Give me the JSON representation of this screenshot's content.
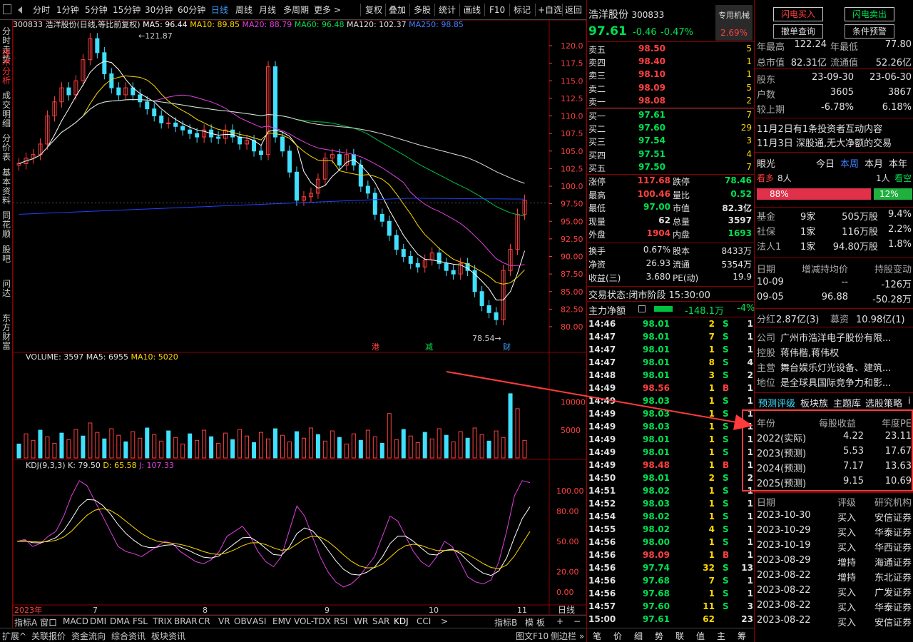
{
  "toolbar": {
    "items": [
      "分时",
      "1分钟",
      "5分钟",
      "15分钟",
      "30分钟",
      "60分钟",
      "日线",
      "周线",
      "月线",
      "多周期",
      "更多 >"
    ],
    "right_items": [
      "复权",
      "叠加",
      "多股",
      "统计",
      "画线",
      "F10",
      "标记",
      "+自选",
      "返回"
    ]
  },
  "left_tabs": [
    "分时走势",
    "技术分析",
    "成交明细",
    "分价表",
    "基本资料",
    "同花顺",
    "股吧",
    "问达",
    "东方财富"
  ],
  "chart": {
    "title": "300833 浩洋股份(日线,等比前复权)",
    "ma5": "MA5: 96.44",
    "ma10": "MA10: 89.85",
    "ma20": "MA20: 88.79",
    "ma60": "MA60: 96.48",
    "ma120": "MA120: 102.37",
    "ma250": "MA250: 98.85",
    "high_mark": "121.87",
    "low_mark": "78.54",
    "price_axis": [
      "120.0",
      "117.5",
      "115.0",
      "112.5",
      "110.0",
      "107.5",
      "105.0",
      "102.5",
      "100.0",
      "97.50",
      "95.00",
      "92.50",
      "90.00",
      "87.50",
      "85.00",
      "82.50",
      "80.00"
    ],
    "event_marks": [
      "港",
      "减",
      "财"
    ],
    "volume_title": "VOLUME: 3597",
    "vol_ma5": "MA5: 6955",
    "vol_ma10": "MA10: 5020",
    "vol_axis": [
      "10000",
      "5000"
    ],
    "kdj_title": "KDJ(9,3,3)",
    "kdj_k": "K: 79.50",
    "kdj_d": "D: 65.58",
    "kdj_j": "J: 107.33",
    "kdj_axis": [
      "100.00",
      "80.00",
      "50.00",
      "20.00",
      "0.00"
    ],
    "x_labels": [
      "2023年",
      "7",
      "8",
      "9",
      "10",
      "11"
    ],
    "period_label": "日线"
  },
  "bottom_tabs": [
    "指标A",
    "窗口",
    "MACD",
    "DMI",
    "DMA",
    "FSL",
    "TRIX",
    "BRAR",
    "CR",
    "VR",
    "OBV",
    "ASI",
    "EMV",
    "VOL-TDX",
    "RSI",
    "WR",
    "SAR",
    "KDJ",
    "CCI",
    ">"
  ],
  "bottom_right": [
    "指标B",
    "模",
    "板"
  ],
  "footer": [
    "扩展^",
    "关联报价",
    "资金流向",
    "综合资讯",
    "板块资讯"
  ],
  "footer_right": [
    "图文F10",
    "侧边栏 »"
  ],
  "quote": {
    "name": "浩洋股份",
    "code": "300833",
    "badge": "专用机械",
    "price": "97.61",
    "change": "-0.46",
    "pct": "-0.47%",
    "badge_pct": "2.69%",
    "asks": [
      {
        "label": "卖五",
        "price": "98.50",
        "vol": "5"
      },
      {
        "label": "卖四",
        "price": "98.40",
        "vol": "1"
      },
      {
        "label": "卖三",
        "price": "98.10",
        "vol": "1"
      },
      {
        "label": "卖二",
        "price": "98.09",
        "vol": "5"
      },
      {
        "label": "卖一",
        "price": "98.08",
        "vol": "2"
      }
    ],
    "bids": [
      {
        "label": "买一",
        "price": "97.61",
        "vol": "7"
      },
      {
        "label": "买二",
        "price": "97.60",
        "vol": "29"
      },
      {
        "label": "买三",
        "price": "97.54",
        "vol": "3"
      },
      {
        "label": "买四",
        "price": "97.51",
        "vol": "4"
      },
      {
        "label": "买五",
        "price": "97.50",
        "vol": "7"
      }
    ],
    "stats": [
      {
        "l1": "涨停",
        "v1": "117.68",
        "c1": "red",
        "l2": "跌停",
        "v2": "78.46",
        "c2": "green"
      },
      {
        "l1": "最高",
        "v1": "100.46",
        "c1": "red",
        "l2": "量比",
        "v2": "0.52",
        "c2": "green"
      },
      {
        "l1": "最低",
        "v1": "97.00",
        "c1": "green",
        "l2": "市值",
        "v2": "82.3亿",
        "c2": "white"
      },
      {
        "l1": "现量",
        "v1": "62",
        "c1": "white",
        "l2": "总量",
        "v2": "3597",
        "c2": "white"
      },
      {
        "l1": "外盘",
        "v1": "1904",
        "c1": "red",
        "l2": "内盘",
        "v2": "1693",
        "c2": "green"
      }
    ],
    "stats2": [
      {
        "l1": "换手",
        "v1": "0.67%",
        "l2": "股本",
        "v2": "8433万"
      },
      {
        "l1": "净资",
        "v1": "26.93",
        "l2": "流通",
        "v2": "5354万"
      },
      {
        "l1": "收益(三)",
        "v1": "3.680",
        "l2": "PE(动)",
        "v2": "19.9"
      }
    ],
    "status_label": "交易状态:",
    "status": "闭市阶段 15:30:00",
    "flow_label": "主力净额",
    "flow_value": "-148.1万",
    "flow_pct": "-4%",
    "ticks": [
      {
        "t": "14:46",
        "p": "98.01",
        "c": "green",
        "v": "2",
        "s": "S",
        "n": "1"
      },
      {
        "t": "14:47",
        "p": "98.01",
        "c": "green",
        "v": "7",
        "s": "S",
        "n": "1"
      },
      {
        "t": "14:47",
        "p": "98.01",
        "c": "green",
        "v": "1",
        "s": "S",
        "n": "1"
      },
      {
        "t": "14:47",
        "p": "98.01",
        "c": "green",
        "v": "8",
        "s": "S",
        "n": "4"
      },
      {
        "t": "14:48",
        "p": "98.01",
        "c": "green",
        "v": "3",
        "s": "S",
        "n": "2"
      },
      {
        "t": "14:49",
        "p": "98.56",
        "c": "red",
        "v": "1",
        "s": "B",
        "n": "1"
      },
      {
        "t": "14:49",
        "p": "98.03",
        "c": "green",
        "v": "1",
        "s": "S",
        "n": "1"
      },
      {
        "t": "14:49",
        "p": "98.03",
        "c": "green",
        "v": "1",
        "s": "S",
        "n": "1"
      },
      {
        "t": "14:49",
        "p": "98.03",
        "c": "green",
        "v": "1",
        "s": "S",
        "n": "1"
      },
      {
        "t": "14:49",
        "p": "98.01",
        "c": "green",
        "v": "1",
        "s": "S",
        "n": "1"
      },
      {
        "t": "14:49",
        "p": "98.01",
        "c": "green",
        "v": "1",
        "s": "S",
        "n": "1"
      },
      {
        "t": "14:49",
        "p": "98.48",
        "c": "red",
        "v": "1",
        "s": "B",
        "n": "1"
      },
      {
        "t": "14:50",
        "p": "98.01",
        "c": "green",
        "v": "2",
        "s": "S",
        "n": "2"
      },
      {
        "t": "14:51",
        "p": "98.02",
        "c": "green",
        "v": "1",
        "s": "S",
        "n": "1"
      },
      {
        "t": "14:52",
        "p": "98.03",
        "c": "green",
        "v": "1",
        "s": "S",
        "n": "1"
      },
      {
        "t": "14:54",
        "p": "98.02",
        "c": "green",
        "v": "1",
        "s": "S",
        "n": "1"
      },
      {
        "t": "14:55",
        "p": "98.02",
        "c": "green",
        "v": "4",
        "s": "S",
        "n": "1"
      },
      {
        "t": "14:56",
        "p": "98.00",
        "c": "green",
        "v": "1",
        "s": "S",
        "n": "1"
      },
      {
        "t": "14:56",
        "p": "98.09",
        "c": "red",
        "v": "1",
        "s": "B",
        "n": "1"
      },
      {
        "t": "14:56",
        "p": "97.74",
        "c": "green",
        "v": "32",
        "s": "S",
        "n": "13"
      },
      {
        "t": "14:56",
        "p": "97.68",
        "c": "green",
        "v": "7",
        "s": "S",
        "n": "1"
      },
      {
        "t": "14:56",
        "p": "97.68",
        "c": "green",
        "v": "1",
        "s": "S",
        "n": "1"
      },
      {
        "t": "14:57",
        "p": "97.60",
        "c": "green",
        "v": "11",
        "s": "S",
        "n": "3"
      },
      {
        "t": "15:00",
        "p": "97.61",
        "c": "green",
        "v": "62",
        "s": "",
        "n": "23"
      }
    ],
    "bottom_tabs": [
      "笔",
      "价",
      "细",
      "势",
      "联",
      "值",
      "主",
      "筹"
    ]
  },
  "right": {
    "buttons": [
      "闪电买入",
      "闪电卖出",
      "撤单查询",
      "条件预警"
    ],
    "top_rows": [
      {
        "a": "年最高",
        "b": "122.24",
        "c": "年最低",
        "d": "77.80"
      },
      {
        "a": "总市值",
        "b": "82.31亿",
        "c": "流通值",
        "d": "52.26亿"
      }
    ],
    "holders_header": {
      "a": "股东",
      "b": "23-09-30",
      "c": "23-06-30"
    },
    "holders": [
      {
        "a": "户数",
        "b": "3605",
        "c": "3867"
      },
      {
        "a": "较上期",
        "b": "-6.78%",
        "c": "6.18%"
      }
    ],
    "news": [
      "11月2日有1条投资者互动内容",
      "11月3日 深股通,无大净额的交易"
    ],
    "eye": {
      "label": "眼光",
      "tabs": [
        "今日",
        "本周",
        "本月",
        "本年"
      ],
      "bull": "看多",
      "bull_n": "8人",
      "bear_n": "1人",
      "bear": "看空",
      "bull_pct": "88%",
      "bear_pct": "12%"
    },
    "funds": [
      {
        "a": "基金",
        "b": "9家",
        "c": "505万股",
        "d": "9.4%"
      },
      {
        "a": "社保",
        "b": "1家",
        "c": "116万股",
        "d": "2.2%"
      },
      {
        "a": "法人1",
        "b": "1家",
        "c": "94.80万股",
        "d": "1.8%"
      }
    ],
    "insider_header": {
      "a": "日期",
      "b": "增减持均价",
      "c": "持股变动"
    },
    "insider": [
      {
        "a": "10-09",
        "b": "--",
        "c": "-126万"
      },
      {
        "a": "09-05",
        "b": "96.88",
        "c": "-50.28万"
      }
    ],
    "dividend": {
      "label": "分红",
      "value": "2.87亿(3)",
      "label2": "募资",
      "value2": "10.98亿(1)"
    },
    "company": [
      {
        "k": "公司",
        "v": "广州市浩洋电子股份有限..."
      },
      {
        "k": "控股",
        "v": "蒋伟楷,蒋伟权"
      },
      {
        "k": "主营",
        "v": "舞台娱乐灯光设备、建筑..."
      },
      {
        "k": "地位",
        "v": "是全球具国际竞争力和影..."
      }
    ],
    "forecast_tabs": [
      "预测评级",
      "板块族",
      "主题库",
      "选股策略",
      "i"
    ],
    "forecast_header": {
      "a": "年份",
      "b": "每股收益",
      "c": "年度PE"
    },
    "forecast": [
      {
        "a": "2022(实际)",
        "b": "4.22",
        "c": "23.11"
      },
      {
        "a": "2023(预测)",
        "b": "5.53",
        "c": "17.67"
      },
      {
        "a": "2024(预测)",
        "b": "7.17",
        "c": "13.63"
      },
      {
        "a": "2025(预测)",
        "b": "9.15",
        "c": "10.69"
      }
    ],
    "ratings_header": {
      "a": "日期",
      "b": "评级",
      "c": "研究机构"
    },
    "ratings": [
      {
        "a": "2023-10-30",
        "b": "买入",
        "c": "安信证券"
      },
      {
        "a": "2023-10-29",
        "b": "买入",
        "c": "华泰证券"
      },
      {
        "a": "2023-10-19",
        "b": "买入",
        "c": "华西证券"
      },
      {
        "a": "2023-08-29",
        "b": "增持",
        "c": "海通证券"
      },
      {
        "a": "2023-08-22",
        "b": "增持",
        "c": "东北证券"
      },
      {
        "a": "2023-08-22",
        "b": "买入",
        "c": "广发证券"
      },
      {
        "a": "2023-08-22",
        "b": "买入",
        "c": "华泰证券"
      },
      {
        "a": "2023-08-22",
        "b": "买入",
        "c": "安信证券"
      }
    ]
  },
  "colors": {
    "up": "#ff4040",
    "down": "#40e0ff",
    "annotation": "#ff3b3b"
  }
}
